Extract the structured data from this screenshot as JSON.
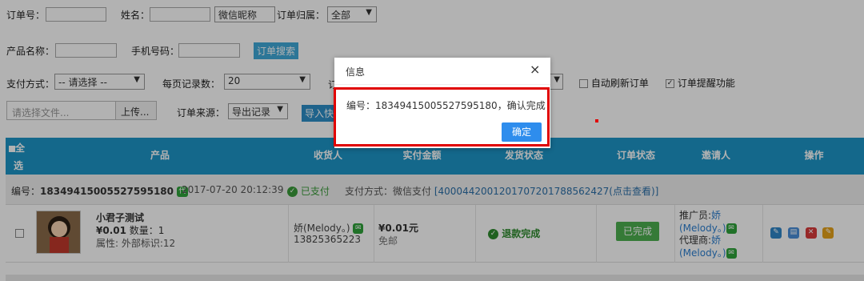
{
  "filters": {
    "order_no_label": "订单号：",
    "name_label": "姓名：",
    "name_type": "微信昵称",
    "order_owner_label": "订单归属：",
    "order_owner_value": "全部",
    "product_label": "产品名称：",
    "phone_label": "手机号码：",
    "search_button": "订单搜索",
    "payment_label": "支付方式：",
    "payment_value": "-- 请选择 --",
    "per_page_label": "每页记录数：",
    "per_page_value": "20",
    "hidden_label_fragment": "订",
    "auto_refresh_label": "自动刷新订单",
    "remind_label": "订单提醒功能",
    "file_placeholder": "请选择文件...",
    "upload_button": "上传...",
    "source_label": "订单来源：",
    "source_value": "导出记录",
    "import_button": "导入快"
  },
  "table": {
    "headers": [
      "全",
      "选",
      "产品",
      "收货人",
      "实付金额",
      "发货状态",
      "订单状态",
      "邀请人",
      "操作"
    ],
    "header_color": "#1e96c8"
  },
  "order": {
    "number_label": "编号：",
    "number": "18349415005527595180",
    "tag": "代",
    "datetime": "2017-07-20 20:12:39",
    "paid_status": "已支付",
    "payment_method": "支付方式：微信支付",
    "transaction": "[4000442001201707201788562427(点击查看)]",
    "product_name": "小君子测试",
    "price": "¥0.01",
    "quantity": "数量：1",
    "attributes": "属性: 外部标识:12",
    "receiver_name": "娇(Melody。)",
    "receiver_phone": "13825365223",
    "paid_amount": "¥0.01元",
    "shipping_fee": "免邮",
    "delivery_status": "退款完成",
    "order_status": "已完成",
    "promoter_label": "推广员:",
    "promoter_name_1": "娇",
    "promoter_name_2": "(Melody。)",
    "agent_label": "代理商:",
    "agent_name_1": "娇",
    "agent_name_2": "(Melody。)"
  },
  "dialog": {
    "title": "信息",
    "close": "×",
    "message": "编号：18349415005527595180，确认完成",
    "confirm": "确定"
  },
  "colors": {
    "accent": "#3fa9d8",
    "success": "#4caf50",
    "highlight_border": "#e00000",
    "confirm": "#2e8ded"
  },
  "icons": [
    "wechat-icon",
    "check-circle-icon",
    "edit-icon",
    "print-icon",
    "delete-icon",
    "note-icon"
  ]
}
